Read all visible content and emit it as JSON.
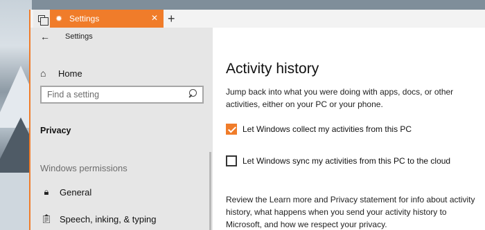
{
  "window": {
    "accent_color": "#f07c2a",
    "tab_label": "Settings",
    "tab_icon": "gear-icon",
    "close_glyph": "✕",
    "new_tab_glyph": "+"
  },
  "sidebar": {
    "back_title": "Settings",
    "home_label": "Home",
    "search_placeholder": "Find a setting",
    "category": "Privacy",
    "section_header": "Windows permissions",
    "items": [
      {
        "label": "General",
        "icon": "lock-icon"
      },
      {
        "label": "Speech, inking, & typing",
        "icon": "clipboard-icon"
      }
    ]
  },
  "main": {
    "title": "Activity history",
    "description": "Jump back into what you were doing with apps, docs, or other activities, either on your PC or your phone.",
    "options": [
      {
        "label": "Let Windows collect my activities from this PC",
        "checked": true
      },
      {
        "label": "Let Windows sync my activities from this PC to the cloud",
        "checked": false
      }
    ],
    "review": "Review the Learn more and Privacy statement for info about activity history, what happens when you send your activity history to Microsoft, and how we respect your privacy."
  }
}
